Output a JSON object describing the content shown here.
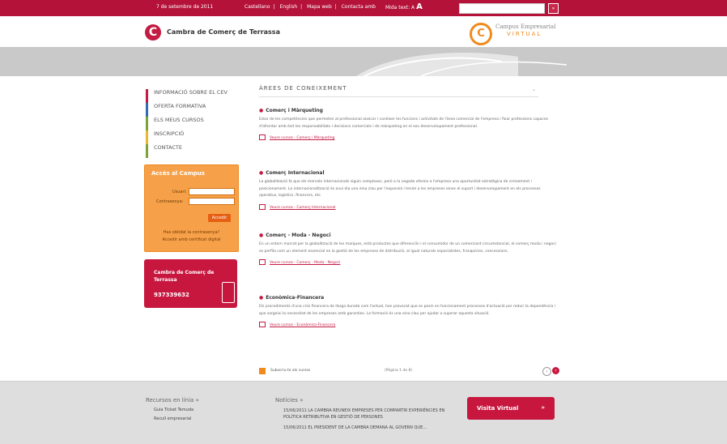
{
  "topbar": {
    "date": "7 de setembre de 2011",
    "links": [
      "Castellano",
      "English",
      "Mapa web",
      "Contacta amb"
    ],
    "separator": "|",
    "text_size_label": "Mida text:",
    "text_size_a": "A",
    "text_size_A": "A",
    "search_placeholder": "",
    "search_button": "»"
  },
  "header": {
    "brand": "Cambra de Comerç de Terrassa",
    "campus_line1": "Campus Empresarial",
    "campus_line2": "VIRTUAL"
  },
  "sidebar": {
    "nav": [
      {
        "label": "INFORMACIÓ SOBRE EL CEV"
      },
      {
        "label": "OFERTA FORMATIVA"
      },
      {
        "label": "ELS MEUS CURSOS"
      },
      {
        "label": "INSCRIPCIÓ"
      },
      {
        "label": "CONTACTE"
      }
    ],
    "login": {
      "title": "Accés al Campus",
      "user_label": "Usuari:",
      "password_label": "Contrasenya:",
      "button": "Accedir",
      "forgot": "Has oblidat la contrasenya?",
      "digital_cert": "Accedir amb certificat digital"
    },
    "phone": {
      "title_line1": "Cambra de Comerç de",
      "title_line2": "Terrassa",
      "number": "937339632"
    }
  },
  "main": {
    "page_title": "ÀREES DE CONEIXEMENT",
    "sections": [
      {
        "heading": "Comerç i Màrqueting",
        "text": "Estar de les competències que permeten al professional aixecar i conèixer les funcions i activitats de l'àrea comercial de l'empresa i fixar professions capaces d'afrontar amb èxit les responsabilitats i decisions comercials i de màrqueting en el seu desenvolupament professional.",
        "link": "Veure cursos - Comerç i Màrqueting"
      },
      {
        "heading": "Comerç Internacional",
        "text": "La globalització fa que els mercats internacionals siguin complexos, però a la vegada ofereix a l'empresa una oportunitat estratègica de creixement i posicionament. La internacionalització és avui dia una eina clau per l'expansió i tenim a les empreses eines el suport i desenvolupament en els processos operatius, logístics, financers, etc.",
        "link": "Veure cursos - Comerç Internacional"
      },
      {
        "heading": "Comerç - Moda - Negoci",
        "text": "En un entorn marcat per la globalització de les marques, està productes que diferenciïn i el consumidor de un comerciant circumstancial, el comerç moda i negoci es perfila com un element essencial en la gestió de les empreses de distribució, al igual naturals especialistes, franquícies, concessions.",
        "link": "Veure cursos - Comerç - Moda - Negoci"
      },
      {
        "heading": "Econòmica-Financera",
        "text": "Els procediments d'una crisi financera de llarga durada com l'actual, han provocat que es posin en funcionament processos d'actuació per reduir la dependència i que sorgeixi la necessitat de les empreses amb garanties. La formació és una eina clau per ajudar a superar aquesta situació.",
        "link": "Veure cursos - Econòmica-Financera"
      }
    ],
    "pager": {
      "subscribe": "Subscriu-te als cursos",
      "pages": "(Pàgina 1 de 8)",
      "prev": "‹",
      "next": "›"
    }
  },
  "footer": {
    "resources": {
      "title": "Recursos en línia",
      "arrow": "»",
      "items": [
        "Guia Ticket Temuda",
        "Recull empresarial"
      ]
    },
    "news": {
      "title": "Notícies",
      "arrow": "»",
      "items": [
        "15/06/2011 LA CAMBRA REUNEIX EMPRESES PER COMPARTIR EXPERIÈNCIES EN POLÍTICA RETRIBUTIVA EN GESTIÓ DE PERSONES",
        "15/06/2011 EL PRESIDENT DE LA CAMBRA DEMANA AL GOVERN QUE..."
      ]
    },
    "virtual_visit": {
      "label": "Visita Virtual",
      "arrow": "»"
    }
  },
  "colors": {
    "brand_red": "#b5123a",
    "orange": "#f6a14a",
    "link_red": "#c31b42"
  }
}
